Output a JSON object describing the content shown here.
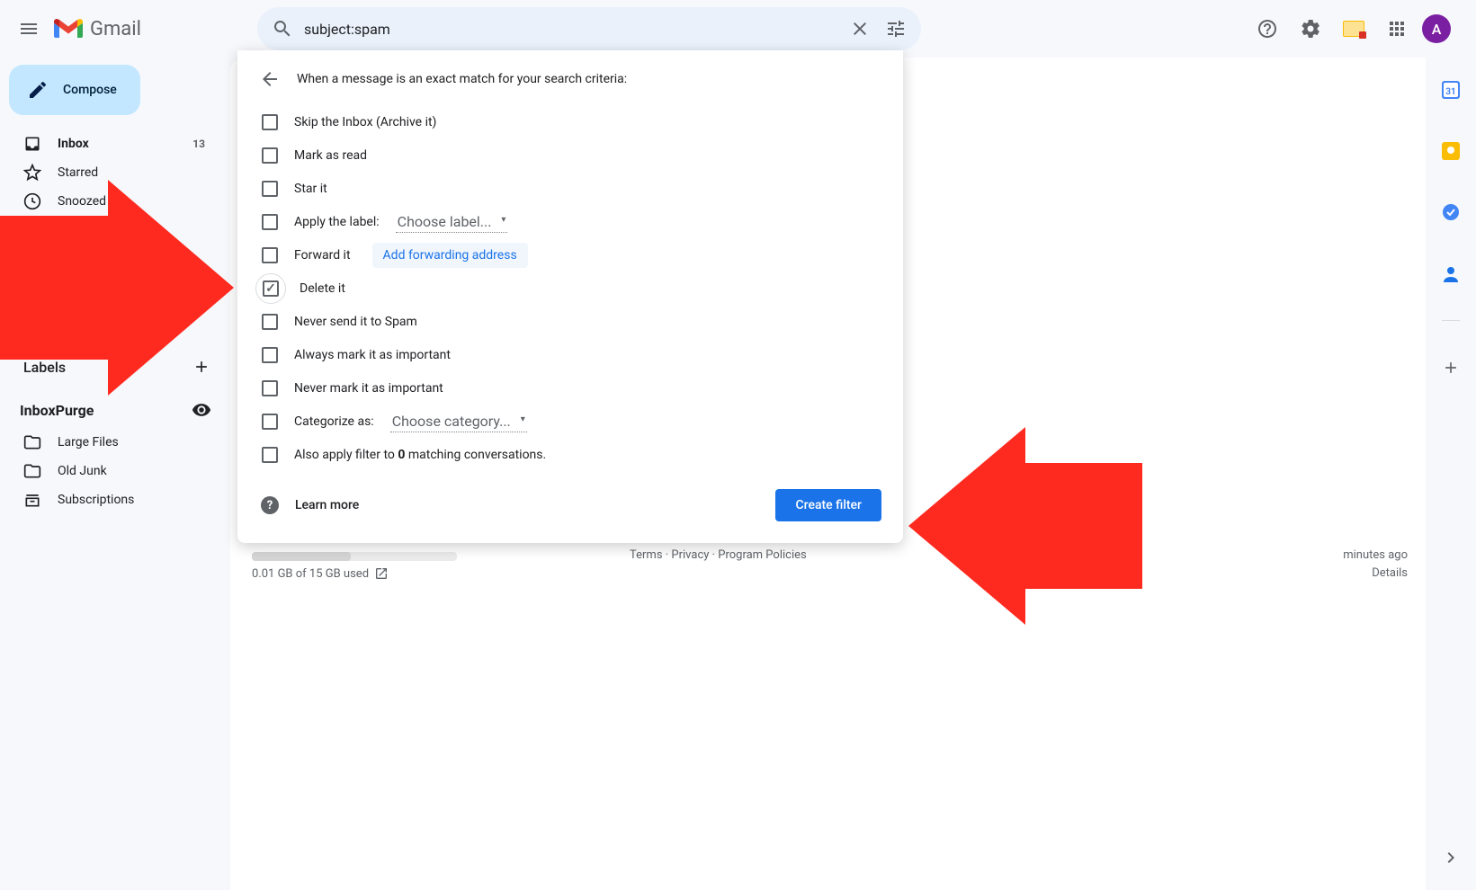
{
  "header": {
    "product_name": "Gmail",
    "search_value": "subject:spam",
    "avatar_initial": "A"
  },
  "sidebar": {
    "compose_label": "Compose",
    "items": [
      {
        "label": "Inbox",
        "icon": "inbox-icon",
        "active": true,
        "count": "13"
      },
      {
        "label": "Starred",
        "icon": "star-icon"
      },
      {
        "label": "Snoozed",
        "icon": "clock-icon"
      }
    ],
    "labels_header": "Labels",
    "inboxpurge_header": "InboxPurge",
    "inboxpurge_items": [
      {
        "label": "Large Files",
        "icon": "file-icon"
      },
      {
        "label": "Old Junk",
        "icon": "folder-icon"
      },
      {
        "label": "Subscriptions",
        "icon": "subscriptions-icon"
      }
    ]
  },
  "filter_panel": {
    "title": "When a message is an exact match for your search criteria:",
    "options": {
      "skip_inbox": "Skip the Inbox (Archive it)",
      "mark_read": "Mark as read",
      "star_it": "Star it",
      "apply_label": "Apply the label:",
      "apply_label_choose": "Choose label...",
      "forward": "Forward it",
      "forward_link": "Add forwarding address",
      "delete_it": "Delete it",
      "never_spam": "Never send it to Spam",
      "always_important": "Always mark it as important",
      "never_important": "Never mark it as important",
      "categorize": "Categorize as:",
      "categorize_choose": "Choose category...",
      "also_apply_pre": "Also apply filter to ",
      "also_apply_count": "0",
      "also_apply_post": " matching conversations."
    },
    "learn_more": "Learn more",
    "create_button": "Create filter"
  },
  "footer": {
    "storage": "0.01 GB of 15 GB used",
    "terms": "Terms",
    "privacy": "Privacy",
    "policies": "Program Policies",
    "activity_line": "minutes ago",
    "details": "Details"
  }
}
